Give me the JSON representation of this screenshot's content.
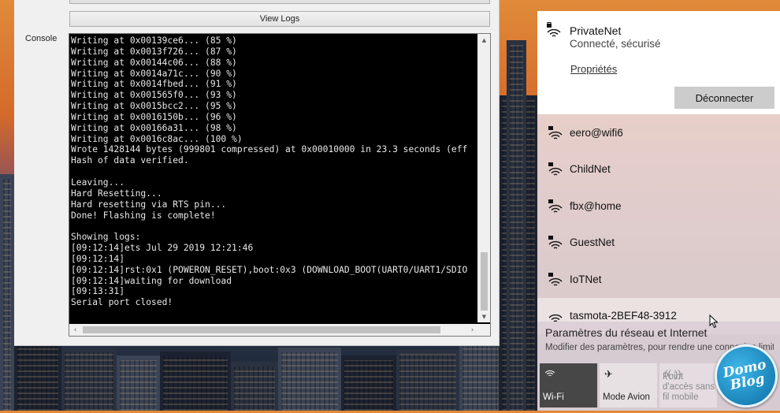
{
  "tool": {
    "view_logs_label": "View Logs",
    "console_label": "Console",
    "console_lines": [
      "Writing at 0x00139ce6... (85 %)",
      "Writing at 0x0013f726... (87 %)",
      "Writing at 0x00144c06... (88 %)",
      "Writing at 0x0014a71c... (90 %)",
      "Writing at 0x0014fbed... (91 %)",
      "Writing at 0x001565f0... (93 %)",
      "Writing at 0x0015bcc2... (95 %)",
      "Writing at 0x0016150b... (96 %)",
      "Writing at 0x00166a31... (98 %)",
      "Writing at 0x0016c8ac... (100 %)",
      "Wrote 1428144 bytes (999801 compressed) at 0x00010000 in 23.3 seconds (eff",
      "Hash of data verified.",
      "",
      "Leaving...",
      "Hard Resetting...",
      "Hard resetting via RTS pin...",
      "Done! Flashing is complete!",
      "",
      "Showing logs:",
      "[09:12:14]ets Jul 29 2019 12:21:46",
      "[09:12:14]",
      "[09:12:14]rst:0x1 (POWERON_RESET),boot:0x3 (DOWNLOAD_BOOT(UART0/UART1/SDIO",
      "[09:12:14]waiting for download",
      "[09:13:31]",
      "Serial port closed!"
    ]
  },
  "network": {
    "connected": {
      "name": "PrivateNet",
      "status": "Connecté, sécurisé",
      "properties_link": "Propriétés",
      "disconnect_label": "Déconnecter"
    },
    "available": [
      {
        "name": "eero@wifi6"
      },
      {
        "name": "ChildNet"
      },
      {
        "name": "fbx@home"
      },
      {
        "name": "GuestNet"
      },
      {
        "name": "IoTNet"
      },
      {
        "name": "tasmota-2BEF48-3912"
      }
    ],
    "settings": {
      "title": "Paramètres du réseau et Internet",
      "subtitle": "Modifier des paramètres, pour rendre une connexion limitée"
    },
    "quick_actions": {
      "wifi": {
        "label": "Wi-Fi",
        "icon": "wifi-icon"
      },
      "airplane": {
        "label": "Mode Avion",
        "icon": "airplane-icon"
      },
      "hotspot": {
        "label": "Point d'accès sans fil mobile",
        "icon": "hotspot-icon"
      }
    }
  },
  "watermark": {
    "line1": "Domo",
    "line2": "Blog"
  },
  "colors": {
    "console_bg": "#000000",
    "console_text": "#e8e8e8",
    "wifi_active_tile": "#474747",
    "disconnect_button": "#cccccc"
  }
}
